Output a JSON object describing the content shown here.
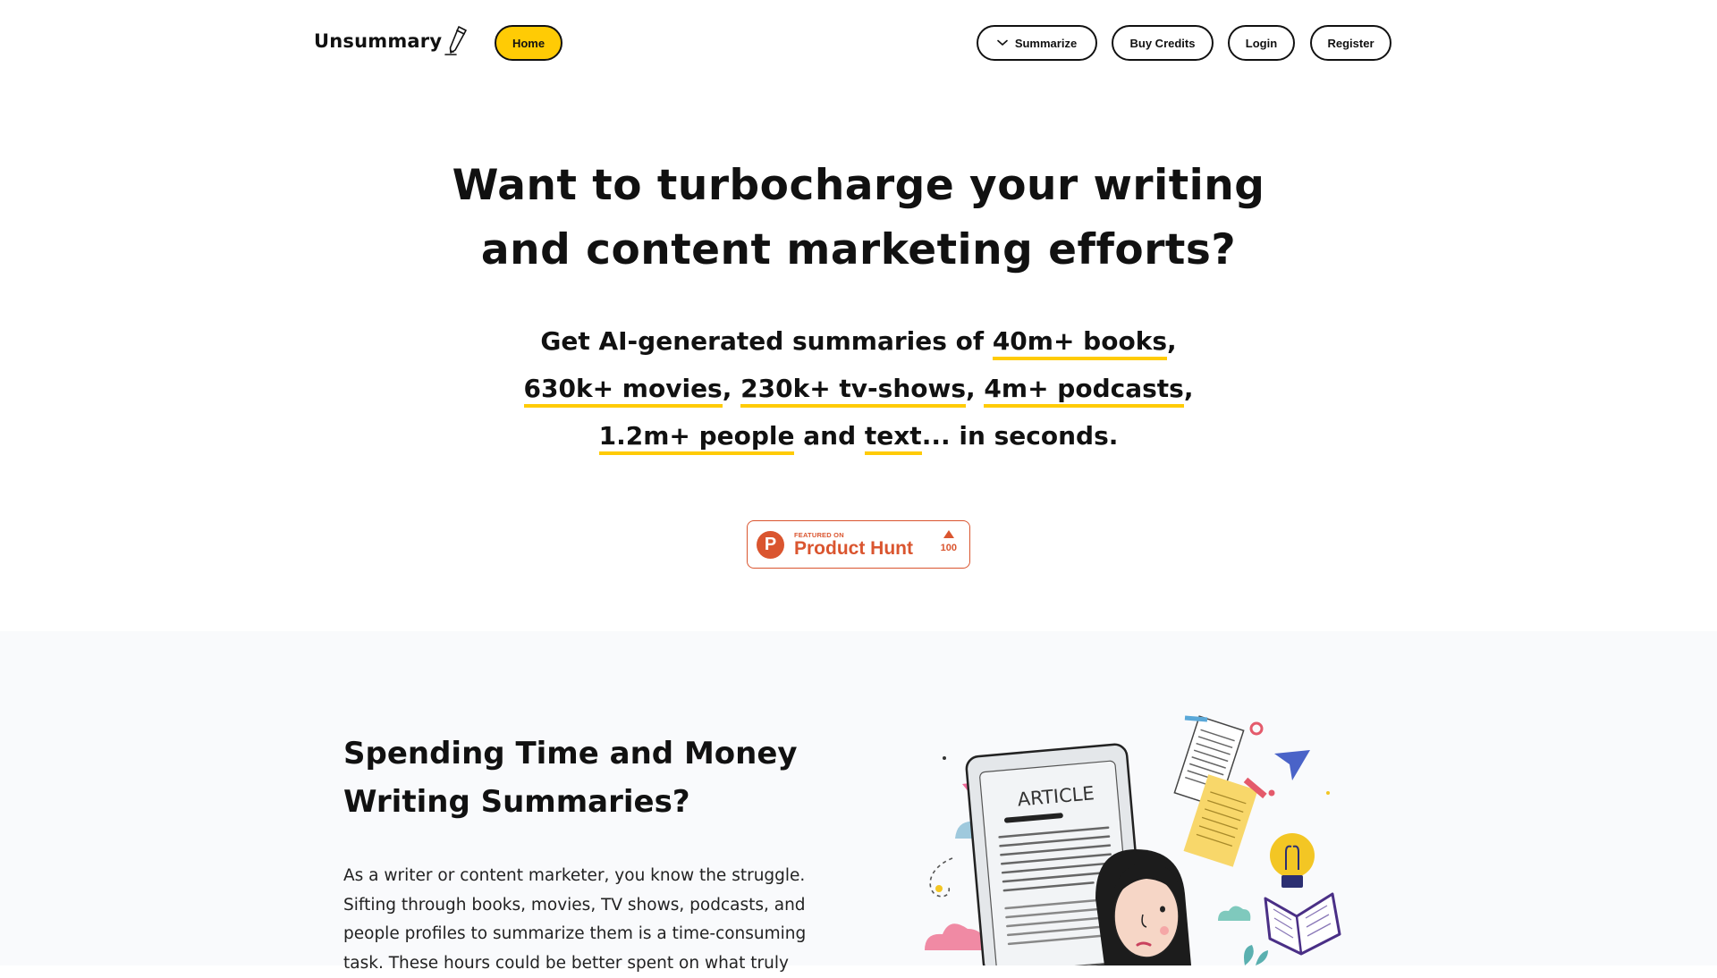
{
  "header": {
    "logo_text": "Unsummary",
    "nav": {
      "home": "Home",
      "summarize": "Summarize",
      "buy_credits": "Buy Credits",
      "login": "Login",
      "register": "Register"
    }
  },
  "hero": {
    "title_line1": "Want to turbocharge your writing",
    "title_line2": "and content marketing efforts?",
    "sub": {
      "lead": "Get AI-generated summaries of",
      "books": "40m+ books",
      "movies": "630k+ movies",
      "tvshows": "230k+ tv-shows",
      "podcasts": "4m+ podcasts",
      "people": "1.2m+ people",
      "and": "and",
      "text": "text",
      "tail": "... in seconds."
    }
  },
  "product_hunt": {
    "logo_letter": "P",
    "featured": "FEATURED ON",
    "name": "Product Hunt",
    "votes": "100"
  },
  "section": {
    "title_line1": "Spending Time and Money",
    "title_line2": "Writing Summaries?",
    "body_lines": [
      "As a writer or content marketer, you know the struggle.",
      "Sifting through books, movies, TV shows, podcasts, and",
      "people profiles to summarize them is a time-consuming",
      "task. These hours could be better spent on what truly"
    ]
  },
  "illustration": {
    "article_label": "ARTICLE"
  },
  "colors": {
    "accent": "#ffcb05",
    "product_hunt": "#da552f",
    "section_bg": "#f9fafc",
    "text": "#111111"
  },
  "icons": {
    "logo": "pencil-icon",
    "summarize": "chevron-down-icon",
    "product_hunt": "product-hunt-logo-icon",
    "upvote": "upvote-triangle-icon"
  }
}
